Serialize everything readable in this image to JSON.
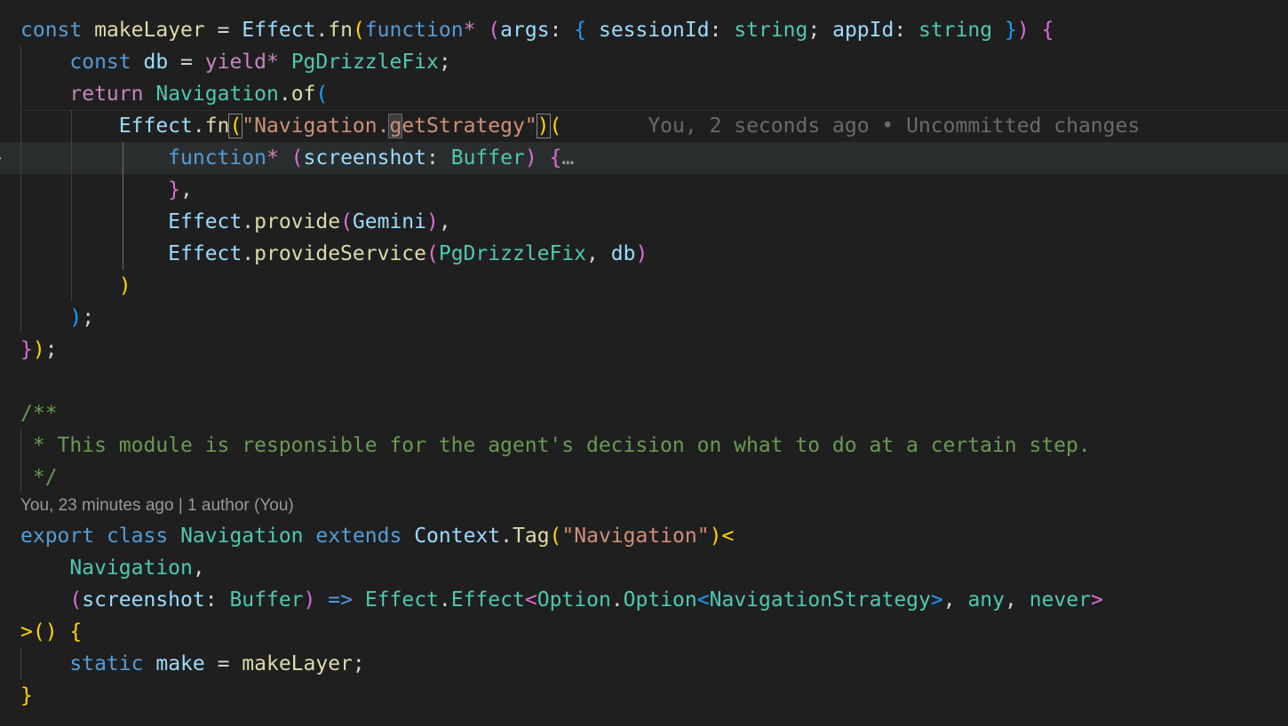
{
  "editor": {
    "language": "typescript",
    "theme_colors": {
      "background": "#1f1f1f",
      "current_line": "#2a2d2e",
      "keyword": "#569cd6",
      "control": "#c586c0",
      "variable": "#9cdcfe",
      "type": "#4ec9b0",
      "function": "#dcdcaa",
      "string": "#ce9178",
      "comment": "#6a9955",
      "bracket_1": "#ffd700",
      "bracket_2": "#da70d6",
      "bracket_3": "#179fff"
    },
    "lines": [
      "const makeLayer = Effect.fn(function* (args: { sessionId: string; appId: string }) {",
      "    const db = yield* PgDrizzleFix;",
      "    return Navigation.of(",
      "        Effect.fn(\"Navigation.getStrategy\")(",
      "            function* (screenshot: Buffer) {",
      "            },",
      "            Effect.provide(Gemini),",
      "            Effect.provideService(PgDrizzleFix, db)",
      "        )",
      "    );",
      "});",
      "",
      "/**",
      " * This module is responsible for the agent's decision on what to do at a certain step.",
      " */",
      "export class Navigation extends Context.Tag(\"Navigation\")<",
      "    Navigation,",
      "    (screenshot: Buffer) => Effect.Effect<Option.Option<NavigationStrategy>, any, never>",
      ">() {",
      "    static make = makeLayer;",
      "}"
    ],
    "inline_blame": "You, 2 seconds ago • Uncommitted changes",
    "codelens": "You, 23 minutes ago | 1 author (You)",
    "folded_ellipsis": "…",
    "fold_icon": "chevron-right-icon",
    "cursor": {
      "line": 4,
      "column": 23
    }
  }
}
